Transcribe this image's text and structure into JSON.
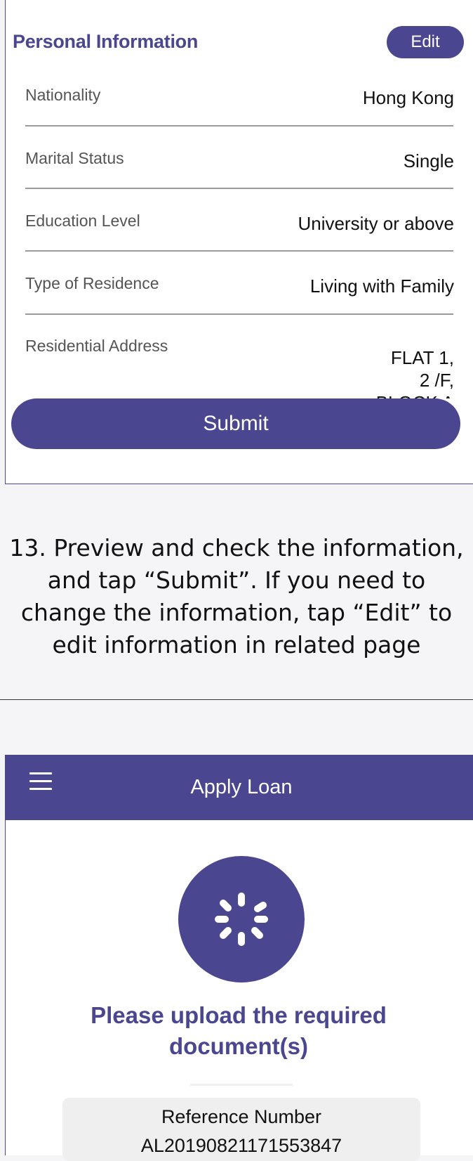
{
  "personal_info": {
    "title": "Personal Information",
    "edit_label": "Edit",
    "rows": [
      {
        "label": "Nationality",
        "value": "Hong Kong"
      },
      {
        "label": "Marital Status",
        "value": "Single"
      },
      {
        "label": "Education Level",
        "value": "University or above"
      },
      {
        "label": "Type of Residence",
        "value": "Living with Family"
      },
      {
        "label": "Residential Address",
        "value": "FLAT 1,\n2 /F,\nBLOCK A"
      }
    ],
    "submit_label": "Submit"
  },
  "instruction": "13. Preview and check the information,\nand tap “Submit”. If you need to\nchange the information, tap “Edit” to\nedit information in related page",
  "apply_screen": {
    "menu_icon": "hamburger-menu-icon",
    "title": "Apply Loan",
    "status_icon": "loading-spinner-icon",
    "message": "Please upload the required document(s)",
    "reference_label": "Reference Number",
    "reference_number": "AL20190821171553847"
  },
  "colors": {
    "brand": "#4a4690",
    "background": "#f5f5f7",
    "divider": "#9a9a9a"
  }
}
